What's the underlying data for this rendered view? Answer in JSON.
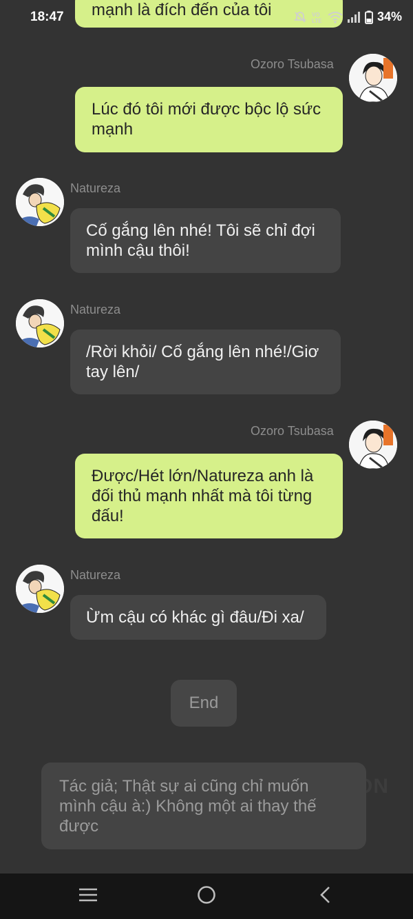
{
  "status_bar": {
    "time": "18:47",
    "battery": "34%",
    "icons": [
      "mute-icon",
      "lte-icon",
      "wifi-icon",
      "signal-icon",
      "battery-icon"
    ]
  },
  "messages": [
    {
      "side": "me",
      "sender": "",
      "text": "mạnh là đích đến của tôi"
    },
    {
      "side": "me",
      "sender": "Ozoro Tsubasa",
      "text": "Lúc đó tôi mới được bộc lộ sức mạnh"
    },
    {
      "side": "them",
      "sender": "Natureza",
      "text": "Cố gắng lên nhé! Tôi sẽ chỉ đợi mình cậu thôi!"
    },
    {
      "side": "them",
      "sender": "Natureza",
      "text": "/Rời khỏi/ Cố gắng lên nhé!/Giơ tay lên/"
    },
    {
      "side": "me",
      "sender": "Ozoro Tsubasa",
      "text": "Được/Hét lớn/Natureza anh là đối thủ mạnh nhất mà tôi từng đấu!"
    },
    {
      "side": "them",
      "sender": "Natureza",
      "text": "Ừm cậu có khác gì đâu/Đi xa/"
    }
  ],
  "end_button": "End",
  "author_note": "Tác giả; Thật sự ai cũng chỉ muốn mình cậu à:) Không một ai thay thế được",
  "watermark": "ON",
  "nav": {
    "icons": [
      "menu-icon",
      "home-icon",
      "back-icon"
    ]
  },
  "colors": {
    "background": "#333333",
    "my_bubble": "#d6f08a",
    "their_bubble": "#444444",
    "sender_name": "#8d8d8d"
  }
}
